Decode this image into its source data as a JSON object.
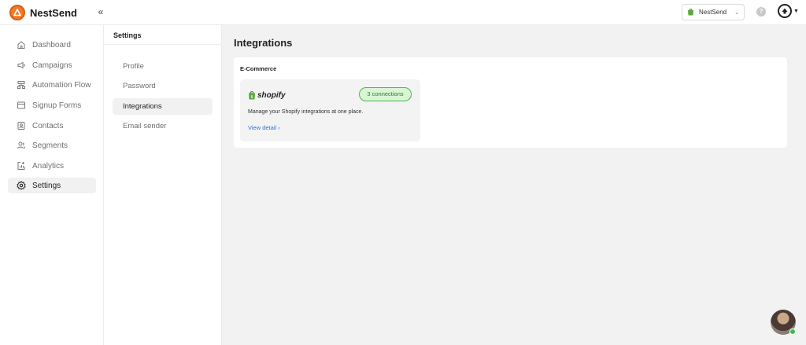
{
  "brand": {
    "name": "NestSend",
    "collapse_label": "«"
  },
  "header": {
    "store_name": "NestSend",
    "help_label": "?"
  },
  "nav": {
    "items": [
      {
        "label": "Dashboard",
        "icon": "home-icon"
      },
      {
        "label": "Campaigns",
        "icon": "megaphone-icon"
      },
      {
        "label": "Automation Flow",
        "icon": "flow-icon"
      },
      {
        "label": "Signup Forms",
        "icon": "form-icon"
      },
      {
        "label": "Contacts",
        "icon": "contacts-icon"
      },
      {
        "label": "Segments",
        "icon": "segments-icon"
      },
      {
        "label": "Analytics",
        "icon": "analytics-icon"
      },
      {
        "label": "Settings",
        "icon": "gear-icon"
      }
    ],
    "active": "Settings"
  },
  "settings": {
    "title": "Settings",
    "items": [
      "Profile",
      "Password",
      "Integrations",
      "Email sender"
    ],
    "active": "Integrations"
  },
  "main": {
    "title": "Integrations",
    "section_heading": "E-Commerce",
    "card": {
      "logo_text": "shopify",
      "badge": "3 connections",
      "description": "Manage your Shopify integrations at one place.",
      "link": "View detail"
    }
  },
  "colors": {
    "brand_orange": "#f07a2b",
    "badge_green": "#4cb84c",
    "link_blue": "#2f6fd6",
    "online_green": "#37c04a"
  }
}
